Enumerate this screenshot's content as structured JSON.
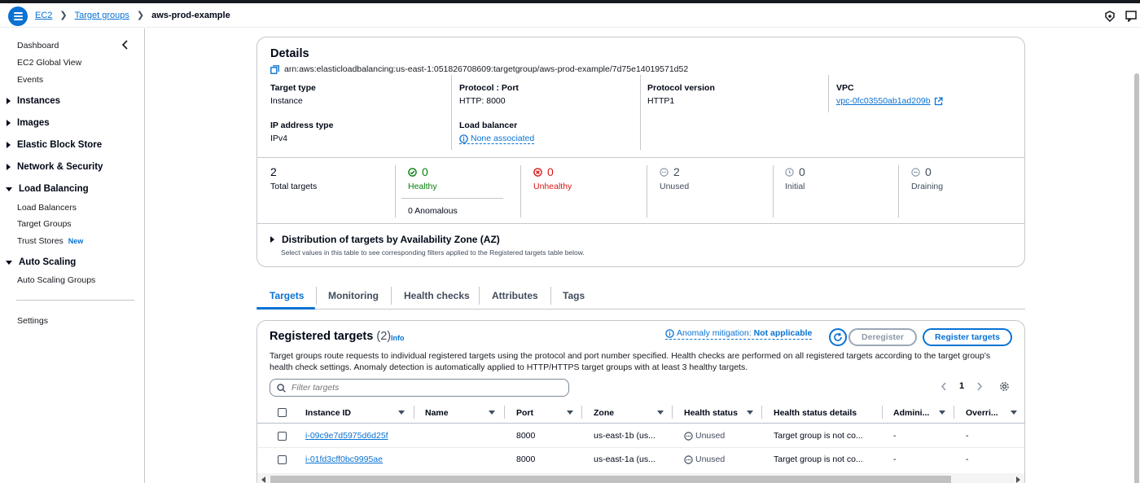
{
  "breadcrumb": {
    "items": [
      "EC2",
      "Target groups"
    ],
    "current": "aws-prod-example"
  },
  "sidebar": {
    "top_items": [
      "Dashboard",
      "EC2 Global View",
      "Events"
    ],
    "sections": [
      {
        "label": "Instances",
        "expanded": false
      },
      {
        "label": "Images",
        "expanded": false
      },
      {
        "label": "Elastic Block Store",
        "expanded": false
      },
      {
        "label": "Network & Security",
        "expanded": false
      },
      {
        "label": "Load Balancing",
        "expanded": true,
        "items": [
          "Load Balancers",
          "Target Groups",
          "Trust Stores"
        ]
      },
      {
        "label": "Auto Scaling",
        "expanded": true,
        "items": [
          "Auto Scaling Groups"
        ]
      }
    ],
    "new_badge": "New",
    "settings": "Settings"
  },
  "details": {
    "title": "Details",
    "arn": "arn:aws:elasticloadbalancing:us-east-1:051826708609:targetgroup/aws-prod-example/7d75e14019571d52",
    "target_type_label": "Target type",
    "target_type": "Instance",
    "protocol_port_label": "Protocol : Port",
    "protocol_port": "HTTP: 8000",
    "protocol_version_label": "Protocol version",
    "protocol_version": "HTTP1",
    "vpc_label": "VPC",
    "vpc": "vpc-0fc03550ab1ad209b",
    "ip_type_label": "IP address type",
    "ip_type": "IPv4",
    "lb_label": "Load balancer",
    "lb": "None associated",
    "stats": {
      "total": "2",
      "total_label": "Total targets",
      "healthy": "0",
      "healthy_label": "Healthy",
      "anomalous": "0 Anomalous",
      "unhealthy": "0",
      "unhealthy_label": "Unhealthy",
      "unused": "2",
      "unused_label": "Unused",
      "initial": "0",
      "initial_label": "Initial",
      "draining": "0",
      "draining_label": "Draining"
    },
    "distribution_title": "Distribution of targets by Availability Zone (AZ)",
    "distribution_sub": "Select values in this table to see corresponding filters applied to the Registered targets table below."
  },
  "tabs": [
    "Targets",
    "Monitoring",
    "Health checks",
    "Attributes",
    "Tags"
  ],
  "registered": {
    "title": "Registered targets",
    "count": "(2)",
    "info": "Info",
    "anomaly_label": "Anomaly mitigation:",
    "anomaly_value": "Not applicable",
    "deregister": "Deregister",
    "register": "Register targets",
    "description": "Target groups route requests to individual registered targets using the protocol and port number specified. Health checks are performed on all registered targets according to the target group's health check settings. Anomaly detection is automatically applied to HTTP/HTTPS target groups with at least 3 healthy targets.",
    "filter_placeholder": "Filter targets",
    "page": "1",
    "columns": [
      "Instance ID",
      "Name",
      "Port",
      "Zone",
      "Health status",
      "Health status details",
      "Admini...",
      "Overri..."
    ],
    "rows": [
      {
        "id": "i-09c9e7d5975d6d25f",
        "name": "",
        "port": "8000",
        "zone": "us-east-1b (us...",
        "health": "Unused",
        "details": "Target group is not co...",
        "admin": "-",
        "override": "-"
      },
      {
        "id": "i-01fd3cff0bc9995ae",
        "name": "",
        "port": "8000",
        "zone": "us-east-1a (us...",
        "health": "Unused",
        "details": "Target group is not co...",
        "admin": "-",
        "override": "-"
      }
    ]
  },
  "colors": {
    "accent": "#0972d3",
    "healthy": "#037f0c",
    "unhealthy": "#d91515",
    "muted": "#8d99a8"
  }
}
